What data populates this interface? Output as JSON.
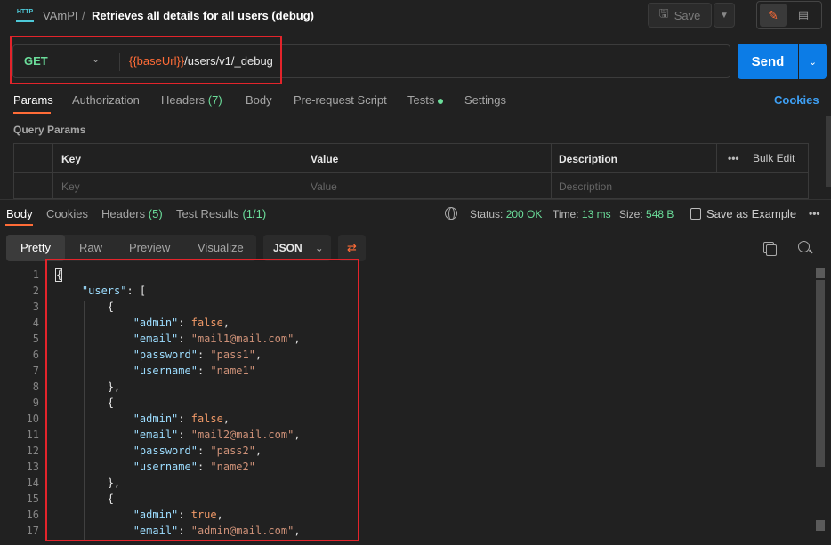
{
  "header": {
    "collection": "VAmPI",
    "separator": "/",
    "request_name": "Retrieves all details for all users (debug)",
    "save_label": "Save"
  },
  "request": {
    "method": "GET",
    "url_var": "{{baseUrl}}",
    "url_path": "/users/v1/_debug",
    "send_label": "Send"
  },
  "req_tabs": {
    "params": "Params",
    "authorization": "Authorization",
    "headers": "Headers",
    "headers_count": "(7)",
    "body": "Body",
    "prerequest": "Pre-request Script",
    "tests": "Tests",
    "settings": "Settings",
    "cookies": "Cookies"
  },
  "query": {
    "title": "Query Params",
    "col_key": "Key",
    "col_value": "Value",
    "col_desc": "Description",
    "bulk_dots": "•••",
    "bulk_edit": "Bulk Edit",
    "ph_key": "Key",
    "ph_value": "Value",
    "ph_desc": "Description"
  },
  "response": {
    "tabs": {
      "body": "Body",
      "cookies": "Cookies",
      "headers": "Headers",
      "headers_count": "(5)",
      "tests": "Test Results",
      "tests_count": "(1/1)"
    },
    "status_label": "Status:",
    "status_value": "200 OK",
    "time_label": "Time:",
    "time_value": "13 ms",
    "size_label": "Size:",
    "size_value": "548 B",
    "save_example": "Save as Example",
    "more": "•••",
    "views": {
      "pretty": "Pretty",
      "raw": "Raw",
      "preview": "Preview",
      "visualize": "Visualize"
    },
    "format": "JSON"
  },
  "code_lines": [
    "1",
    "2",
    "3",
    "4",
    "5",
    "6",
    "7",
    "8",
    "9",
    "10",
    "11",
    "12",
    "13",
    "14",
    "15",
    "16",
    "17"
  ],
  "code": {
    "users_key": "\"users\"",
    "admin_key": "\"admin\"",
    "email_key": "\"email\"",
    "password_key": "\"password\"",
    "username_key": "\"username\"",
    "u1_admin": "false",
    "u1_email": "\"mail1@mail.com\"",
    "u1_password": "\"pass1\"",
    "u1_username": "\"name1\"",
    "u2_admin": "false",
    "u2_email": "\"mail2@mail.com\"",
    "u2_password": "\"pass2\"",
    "u2_username": "\"name2\"",
    "u3_admin": "true",
    "u3_email": "\"admin@mail.com\""
  },
  "colors": {
    "accent": "#ff6c37",
    "send": "#0c7ce6",
    "method_get": "#6bdd9a",
    "highlight_box": "#e3242b"
  }
}
